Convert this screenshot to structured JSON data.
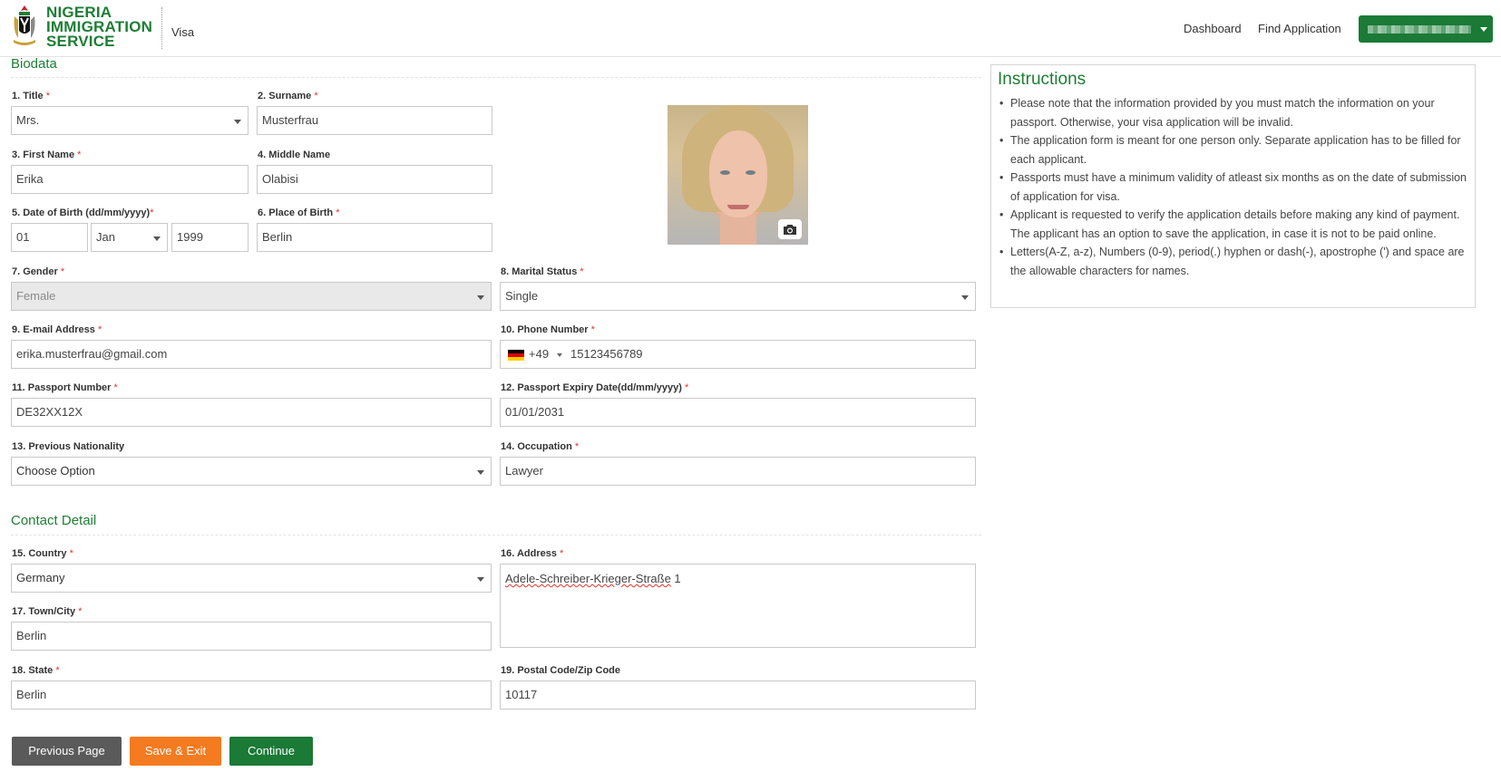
{
  "header": {
    "brand_line1": "NIGERIA",
    "brand_line2": "IMMIGRATION",
    "brand_line3": "SERVICE",
    "app_name": "Visa",
    "nav": [
      "Dashboard",
      "Find Application"
    ],
    "brand_color": "#1e7e34"
  },
  "sections": {
    "biodata": "Biodata",
    "contact": "Contact Detail"
  },
  "required_mark": "*",
  "fields": {
    "title": {
      "label": "1. Title",
      "value": "Mrs."
    },
    "surname": {
      "label": "2. Surname",
      "value": "Musterfrau"
    },
    "first_name": {
      "label": "3. First Name",
      "value": "Erika"
    },
    "middle_name": {
      "label": "4. Middle Name",
      "value": "Olabisi"
    },
    "dob": {
      "label": "5. Date of Birth (dd/mm/yyyy)",
      "day": "01",
      "month": "Jan",
      "year": "1999"
    },
    "place_of_birth": {
      "label": "6. Place of Birth",
      "value": "Berlin"
    },
    "gender": {
      "label": "7. Gender",
      "value": "Female"
    },
    "marital_status": {
      "label": "8. Marital Status",
      "value": "Single"
    },
    "email": {
      "label": "9. E-mail Address",
      "value": "erika.musterfrau@gmail.com"
    },
    "phone": {
      "label": "10. Phone Number",
      "dial_code": "+49",
      "value": "15123456789"
    },
    "passport_number": {
      "label": "11. Passport Number",
      "value": "DE32XX12X"
    },
    "passport_expiry": {
      "label": "12. Passport Expiry Date(dd/mm/yyyy)",
      "value": "01/01/2031"
    },
    "previous_nationality": {
      "label": "13. Previous Nationality",
      "value": "Choose Option"
    },
    "occupation": {
      "label": "14. Occupation",
      "value": "Lawyer"
    },
    "country": {
      "label": "15. Country",
      "value": "Germany"
    },
    "address": {
      "label": "16. Address",
      "value_misspelled": "Adele-Schreiber-Krieger-Straße",
      "value_rest": " 1"
    },
    "town": {
      "label": "17. Town/City",
      "value": "Berlin"
    },
    "state": {
      "label": "18. State",
      "value": "Berlin"
    },
    "postal": {
      "label": "19. Postal Code/Zip Code",
      "value": "10117"
    }
  },
  "instructions": {
    "title": "Instructions",
    "items": [
      "Please note that the information provided by you must match the information on your passport. Otherwise, your visa application will be invalid.",
      "The application form is meant for one person only. Separate application has to be filled for each applicant.",
      "Passports must have a minimum validity of atleast six months as on the date of submission of application for visa.",
      "Applicant is requested to verify the application details before making any kind of payment. The applicant has an option to save the application, in case it is not to be paid online.",
      "Letters(A-Z, a-z), Numbers (0-9), period(.) hyphen or dash(-), apostrophe (') and space are the allowable characters for names."
    ]
  },
  "buttons": {
    "previous": "Previous Page",
    "save": "Save & Exit",
    "continue": "Continue"
  }
}
